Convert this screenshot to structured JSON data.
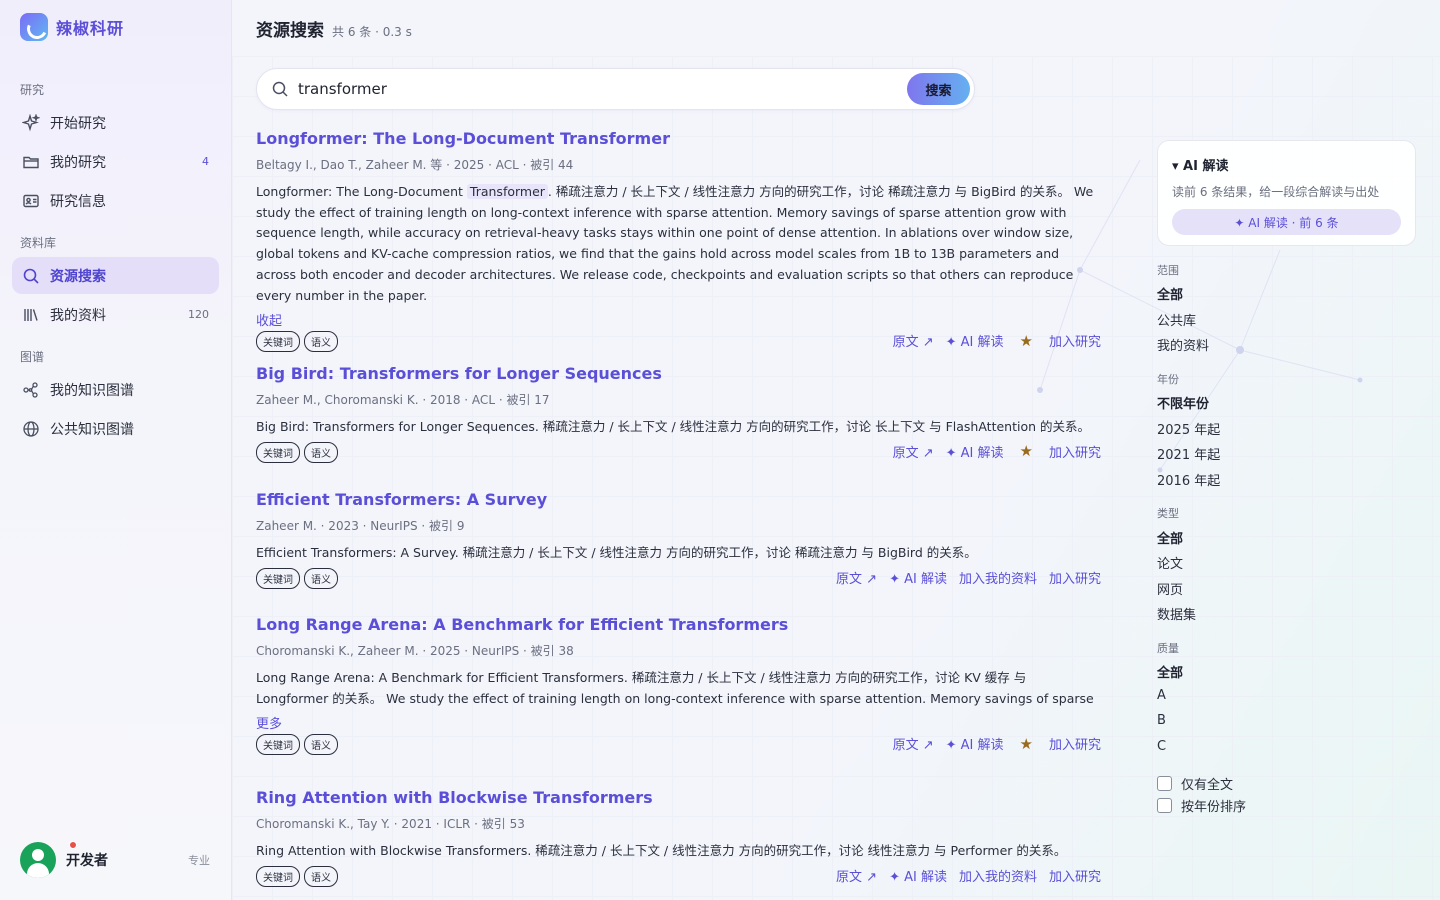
{
  "brand": {
    "name": "辣椒科研"
  },
  "sidebar": {
    "sections": [
      "研究",
      "资料库",
      "图谱"
    ],
    "items": [
      {
        "label": "开始研究",
        "icon": "sparkle-icon",
        "count": ""
      },
      {
        "label": "我的研究",
        "icon": "folder-icon",
        "count": "4"
      },
      {
        "label": "研究信息",
        "icon": "id-card-icon",
        "count": ""
      },
      {
        "label": "资源搜索",
        "icon": "search-icon",
        "count": ""
      },
      {
        "label": "我的资料",
        "icon": "library-icon",
        "count": "120"
      },
      {
        "label": "我的知识图谱",
        "icon": "graph-icon",
        "count": ""
      },
      {
        "label": "公共知识图谱",
        "icon": "globe-icon",
        "count": ""
      }
    ],
    "active": "资源搜索"
  },
  "user": {
    "name": "开发者",
    "plan": "专业"
  },
  "header": {
    "title": "资源搜索",
    "meta": "共 6 条 · 0.3 s"
  },
  "search": {
    "value": "transformer",
    "button": "搜索"
  },
  "results": [
    {
      "title": "Longformer: The Long-Document Transformer",
      "meta": "Beltagy I., Dao T., Zaheer M. 等 · 2025 · ACL · 被引 44",
      "abstract_pre": "Longformer: The Long-Document ",
      "abstract_hl": "Transformer",
      "abstract_post": ". 稀疏注意力 / 长上下文 / 线性注意力 方向的研究工作，讨论 稀疏注意力 与 BigBird 的关系。 We study the effect of training length on long-context inference with sparse attention. Memory savings of sparse attention grow with sequence length, while accuracy on retrieval-heavy tasks stays within one point of dense attention. In ablations over window size, global tokens and KV-cache compression ratios, we find that the gains hold across model scales from 1B to 13B parameters and across both encoder and decoder architectures. We release code, checkpoints and evaluation scripts so that others can reproduce every number in the paper.",
      "toggle": "收起",
      "tags": [
        "关键词",
        "语义"
      ],
      "actions": [
        "原文 ↗",
        "✦ AI 解读",
        "★",
        "加入研究"
      ]
    },
    {
      "title": "Big Bird: Transformers for Longer Sequences",
      "meta": "Zaheer M., Choromanski K. · 2018 · ACL · 被引 17",
      "abstract": "Big Bird: Transformers for Longer Sequences. 稀疏注意力 / 长上下文 / 线性注意力 方向的研究工作，讨论 长上下文 与 FlashAttention 的关系。",
      "tags": [
        "关键词",
        "语义"
      ],
      "actions": [
        "原文 ↗",
        "✦ AI 解读",
        "★",
        "加入研究"
      ]
    },
    {
      "title": "Efficient Transformers: A Survey",
      "meta": "Zaheer M. · 2023 · NeurIPS · 被引 9",
      "abstract": "Efficient Transformers: A Survey. 稀疏注意力 / 长上下文 / 线性注意力 方向的研究工作，讨论 稀疏注意力 与 BigBird 的关系。",
      "tags": [
        "关键词",
        "语义"
      ],
      "actions": [
        "原文 ↗",
        "✦ AI 解读",
        "加入我的资料",
        "加入研究"
      ]
    },
    {
      "title": "Long Range Arena: A Benchmark for Efficient Transformers",
      "meta": "Choromanski K., Zaheer M. · 2025 · NeurIPS · 被引 38",
      "abstract": "Long Range Arena: A Benchmark for Efficient Transformers. 稀疏注意力 / 长上下文 / 线性注意力 方向的研究工作，讨论 KV 缓存 与 Longformer 的关系。 We study the effect of training length on long-context inference with sparse attention. Memory savings of sparse attention grow...",
      "toggle": "更多",
      "tags": [
        "关键词",
        "语义"
      ],
      "actions": [
        "原文 ↗",
        "✦ AI 解读",
        "★",
        "加入研究"
      ]
    },
    {
      "title": "Ring Attention with Blockwise Transformers",
      "meta": "Choromanski K., Tay Y. · 2021 · ICLR · 被引 53",
      "abstract": "Ring Attention with Blockwise Transformers. 稀疏注意力 / 长上下文 / 线性注意力 方向的研究工作，讨论 线性注意力 与 Performer 的关系。",
      "tags": [
        "关键词",
        "语义"
      ],
      "actions": [
        "原文 ↗",
        "✦ AI 解读",
        "加入我的资料",
        "加入研究"
      ]
    }
  ],
  "ai_card": {
    "title": "▾ AI 解读",
    "desc": "读前 6 条结果，给一段综合解读与出处",
    "button": "✦ AI 解读 · 前 6 条"
  },
  "filters": {
    "scope": {
      "label": "范围",
      "options": [
        "全部",
        "公共库",
        "我的资料"
      ],
      "selected": "全部"
    },
    "year": {
      "label": "年份",
      "options": [
        "不限年份",
        "2025 年起",
        "2021 年起",
        "2016 年起"
      ],
      "selected": "不限年份"
    },
    "type": {
      "label": "类型",
      "options": [
        "全部",
        "论文",
        "网页",
        "数据集"
      ],
      "selected": "全部"
    },
    "quality": {
      "label": "质量",
      "options": [
        "全部",
        "A",
        "B",
        "C"
      ],
      "selected": "全部"
    },
    "checks": [
      "仅有全文",
      "按年份排序"
    ]
  },
  "colors": {
    "accent": "#5b4fd8",
    "star": "#9a6b1e",
    "avatar": "#19a35a"
  }
}
